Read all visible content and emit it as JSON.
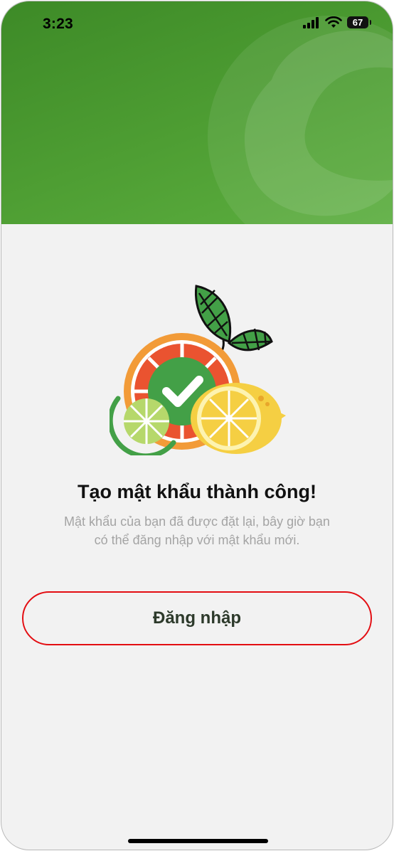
{
  "status_bar": {
    "time": "3:23",
    "battery": "67"
  },
  "main": {
    "title": "Tạo mật khẩu thành công!",
    "message": "Mật khẩu của bạn đã được đặt lại, bây giờ bạn có thể đăng nhập với mật khẩu mới.",
    "login_button": "Đăng nhập"
  },
  "colors": {
    "header_green": "#4e9e33",
    "button_border": "#e30d12",
    "check_green": "#43a047",
    "orange": "#f29b38"
  },
  "icons": [
    "signal-icon",
    "wifi-icon",
    "battery-icon",
    "fruit-checkmark-illustration"
  ]
}
